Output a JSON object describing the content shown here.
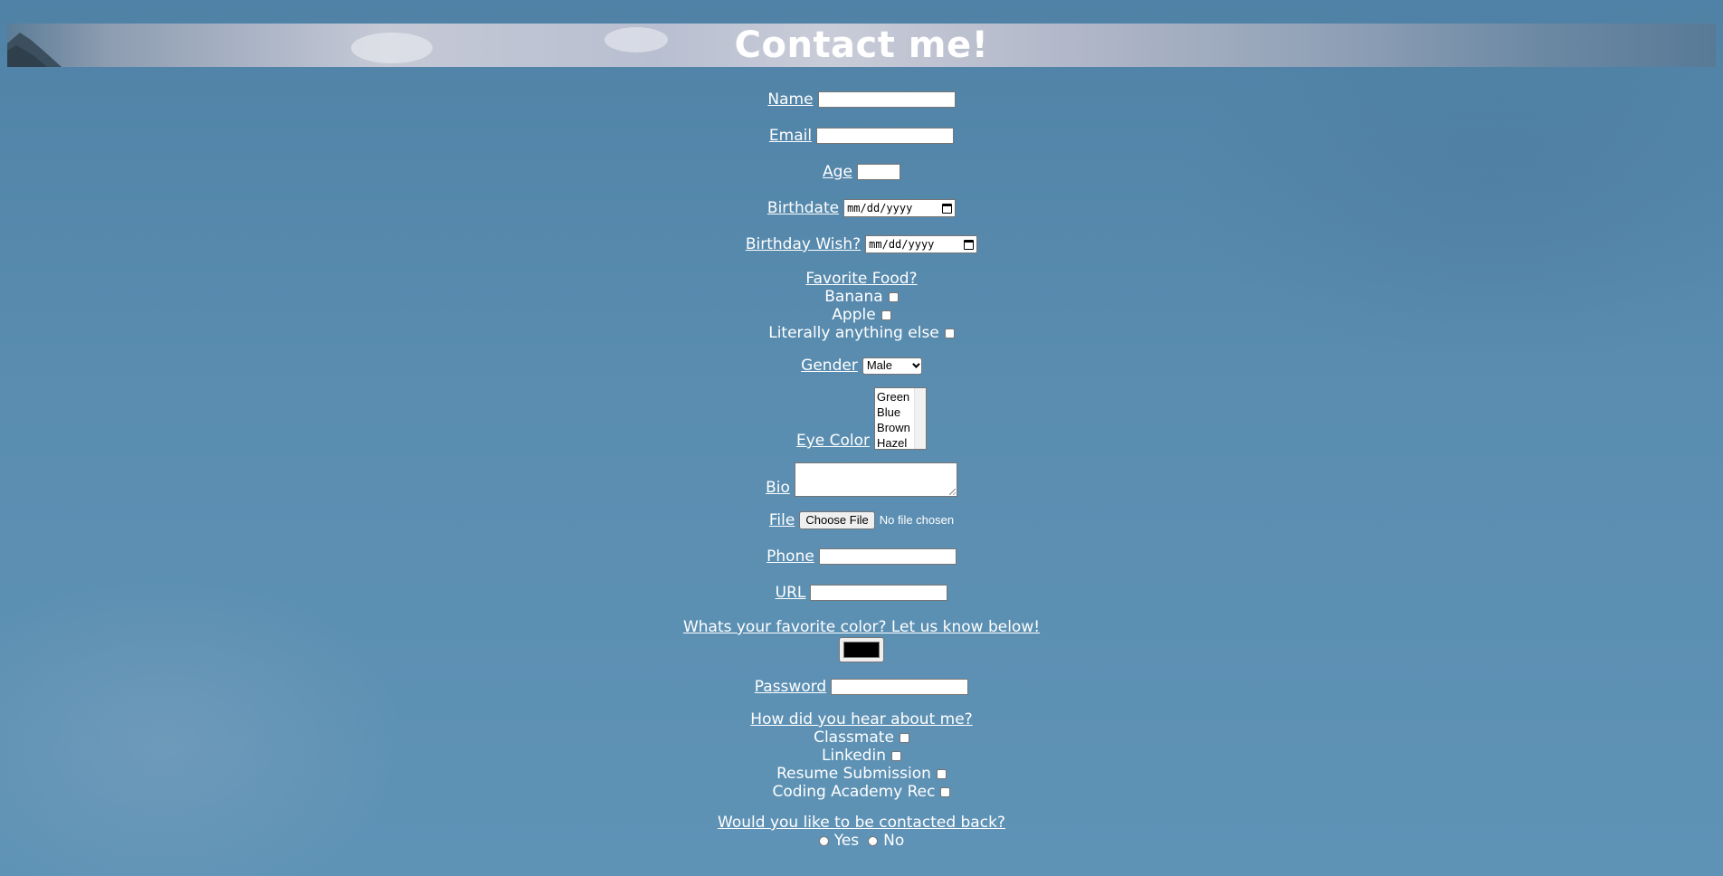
{
  "header": {
    "title": "Contact me!"
  },
  "form": {
    "name": {
      "label": "Name",
      "value": ""
    },
    "email": {
      "label": "Email",
      "value": ""
    },
    "age": {
      "label": "Age",
      "value": ""
    },
    "birthdate": {
      "label": "Birthdate",
      "placeholder": "mm/dd/yyyy"
    },
    "birthday_wish": {
      "label": "Birthday Wish?",
      "placeholder": "mm/dd/yyyy"
    },
    "favorite_food": {
      "label": "Favorite Food?",
      "options": [
        {
          "label": "Banana",
          "checked": false
        },
        {
          "label": "Apple",
          "checked": false
        },
        {
          "label": "Literally anything else",
          "checked": false
        }
      ]
    },
    "gender": {
      "label": "Gender",
      "selected": "Male"
    },
    "eye_color": {
      "label": "Eye Color",
      "options": [
        "Green",
        "Blue",
        "Brown",
        "Hazel"
      ]
    },
    "bio": {
      "label": "Bio",
      "value": ""
    },
    "file": {
      "label": "File",
      "button": "Choose File",
      "status": "No file chosen"
    },
    "phone": {
      "label": "Phone",
      "value": ""
    },
    "url": {
      "label": "URL",
      "value": ""
    },
    "favorite_color": {
      "label": "Whats your favorite color? Let us know below!",
      "value": "#000000"
    },
    "password": {
      "label": "Password",
      "value": ""
    },
    "heard_about": {
      "label": "How did you hear about me?",
      "options": [
        {
          "label": "Classmate",
          "checked": false
        },
        {
          "label": "Linkedin",
          "checked": false
        },
        {
          "label": "Resume Submission",
          "checked": false
        },
        {
          "label": "Coding Academy Rec",
          "checked": false
        }
      ]
    },
    "contact_back": {
      "label": "Would you like to be contacted back?",
      "options": [
        {
          "label": "Yes",
          "selected": false
        },
        {
          "label": "No",
          "selected": false
        }
      ]
    }
  }
}
